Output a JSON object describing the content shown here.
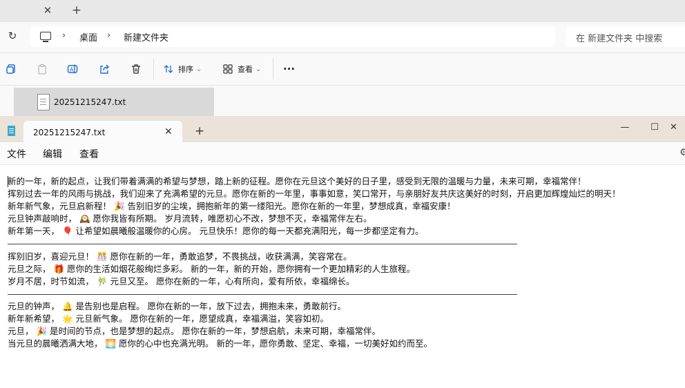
{
  "explorer": {
    "tab_close": "✕",
    "tab_add": "+",
    "refresh": "↻",
    "breadcrumb": {
      "sep1": "›",
      "desktop": "桌面",
      "sep2": "›",
      "folder": "新建文件夹"
    },
    "search_placeholder": "在 新建文件夹 中搜索",
    "toolbar": {
      "sort_label": "排序",
      "view_label": "查看",
      "more": "···",
      "chevron": "⌄"
    },
    "file_name": "20251215247.txt"
  },
  "notepad": {
    "tab_title": "20251215247.txt",
    "tab_close": "✕",
    "tab_add": "+",
    "controls": {
      "minimize": "—",
      "maximize": "☐",
      "close": "✕"
    },
    "menu": {
      "file": "文件",
      "edit": "编辑",
      "view": "查看"
    },
    "settings_icon": "⚙",
    "lines": [
      "新的一年，新的起点，让我们带着满满的希望与梦想，踏上新的征程。愿你在元旦这个美好的日子里，感受到无限的温暖与力量，未来可期，幸福常伴！",
      "挥别过去一年的风雨与挑战，我们迎来了充满希望的元旦。愿你在新的一年里，事事如意，笑口常开，与亲朋好友共庆这美好的时刻，开启更加辉煌灿烂的明天！",
      "新年新气象，元旦启新程！ 🎉 告别旧岁的尘埃，拥抱新年的第一缕阳光。愿你在新的一年里，梦想成真，幸福安康！",
      "元旦钟声敲响时， 🕰️ 愿你我皆有所期。 岁月流转，唯愿初心不改，梦想不灭，幸福常伴左右。",
      "新年第一天， 🎈 让希望如晨曦般温暖你的心房。 元旦快乐！愿你的每一天都充满阳光，每一步都坚定有力。",
      "",
      "挥别旧岁，喜迎元旦！ 🎊 愿你在新的一年，勇敢追梦，不畏挑战，收获满满，笑容常在。",
      "元旦之际， 🎁 愿你的生活如烟花般绚烂多彩。 新的一年，新的开始，愿你拥有一个更加精彩的人生旅程。",
      "岁月不居，时节如流， 🎋 元旦又至。 愿你在新的一年，心有所向，爱有所依，幸福绵长。",
      "",
      "元旦的钟声， 🔔 是告别也是启程。 愿你在新的一年，放下过去，拥抱未来，勇敢前行。",
      "新年新希望， 🌟 元旦新气象。 愿你在新的一年，愿望成真，幸福满溢，笑容如初。",
      "元旦， 🎉 是时间的节点，也是梦想的起点。 愿你在新的一年，梦想启航，未来可期，幸福常伴。",
      "当元旦的晨曦洒满大地， 🌅 愿你的心中也充满光明。 新的一年，愿你勇敢、坚定、幸福，一切美好如约而至。"
    ]
  }
}
